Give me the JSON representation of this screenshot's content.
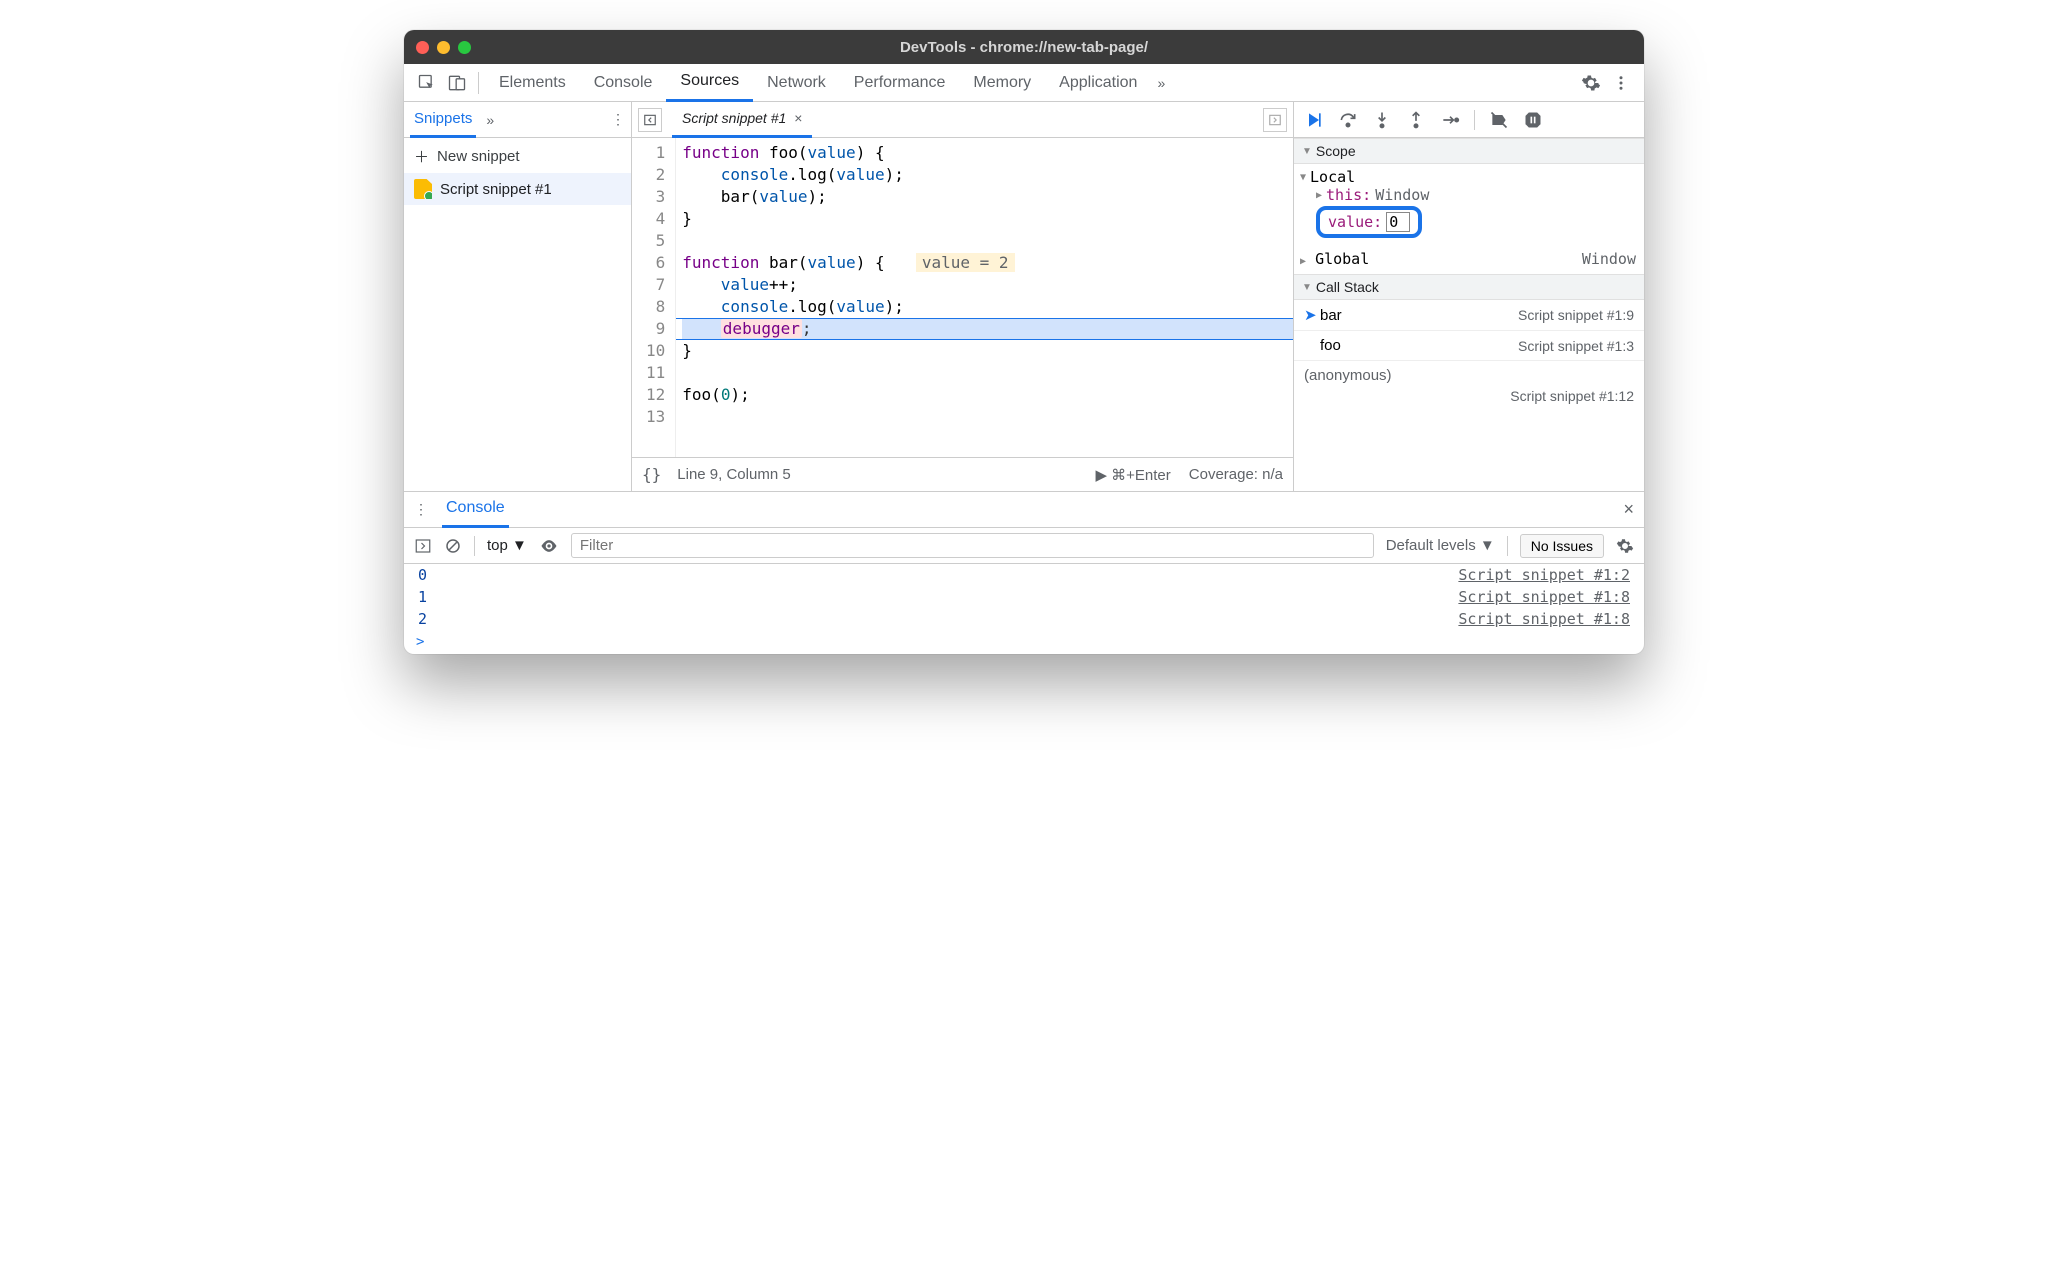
{
  "window": {
    "title": "DevTools - chrome://new-tab-page/"
  },
  "tabs": {
    "items": [
      "Elements",
      "Console",
      "Sources",
      "Network",
      "Performance",
      "Memory",
      "Application"
    ],
    "active": "Sources",
    "overflow": "»"
  },
  "leftPane": {
    "tab": "Snippets",
    "newLabel": "New snippet",
    "items": [
      "Script snippet #1"
    ]
  },
  "editor": {
    "fileName": "Script snippet #1",
    "lines": [
      {
        "n": 1,
        "html": "<span class='kw'>function</span> <span class='fn'>foo</span>(<span class='var'>value</span>) {"
      },
      {
        "n": 2,
        "html": "    <span class='var'>console</span>.<span class='fn'>log</span>(<span class='var'>value</span>);"
      },
      {
        "n": 3,
        "html": "    <span class='fn'>bar</span>(<span class='var'>value</span>);"
      },
      {
        "n": 4,
        "html": "}"
      },
      {
        "n": 5,
        "html": ""
      },
      {
        "n": 6,
        "html": "<span class='kw'>function</span> <span class='fn'>bar</span>(<span class='var'>value</span>) {  <span class='hint'>value = 2</span>"
      },
      {
        "n": 7,
        "html": "    <span class='var'>value</span>++;"
      },
      {
        "n": 8,
        "html": "    <span class='var'>console</span>.<span class='fn'>log</span>(<span class='var'>value</span>);"
      },
      {
        "n": 9,
        "html": "    <span class='debugger-kw'>debugger</span><span class='punct'>;</span>",
        "current": true
      },
      {
        "n": 10,
        "html": "}"
      },
      {
        "n": 11,
        "html": ""
      },
      {
        "n": 12,
        "html": "<span class='fn'>foo</span>(<span class='num'>0</span>);"
      },
      {
        "n": 13,
        "html": ""
      }
    ],
    "statusBraces": "{}",
    "statusPos": "Line 9, Column 5",
    "statusRun": "▶ ⌘+Enter",
    "statusCoverage": "Coverage: n/a"
  },
  "scope": {
    "header": "Scope",
    "localLabel": "Local",
    "thisLabel": "this",
    "thisVal": "Window",
    "valueLabel": "value",
    "valueVal": "0",
    "globalLabel": "Global",
    "globalVal": "Window"
  },
  "callstack": {
    "header": "Call Stack",
    "frames": [
      {
        "name": "bar",
        "loc": "Script snippet #1:9",
        "current": true
      },
      {
        "name": "foo",
        "loc": "Script snippet #1:3",
        "current": false
      }
    ],
    "anonName": "(anonymous)",
    "anonLoc": "Script snippet #1:12"
  },
  "drawer": {
    "tab": "Console",
    "context": "top",
    "filterPlaceholder": "Filter",
    "levels": "Default levels",
    "issues": "No Issues",
    "lines": [
      {
        "val": "0",
        "src": "Script snippet #1:2"
      },
      {
        "val": "1",
        "src": "Script snippet #1:8"
      },
      {
        "val": "2",
        "src": "Script snippet #1:8"
      }
    ],
    "prompt": ">"
  }
}
